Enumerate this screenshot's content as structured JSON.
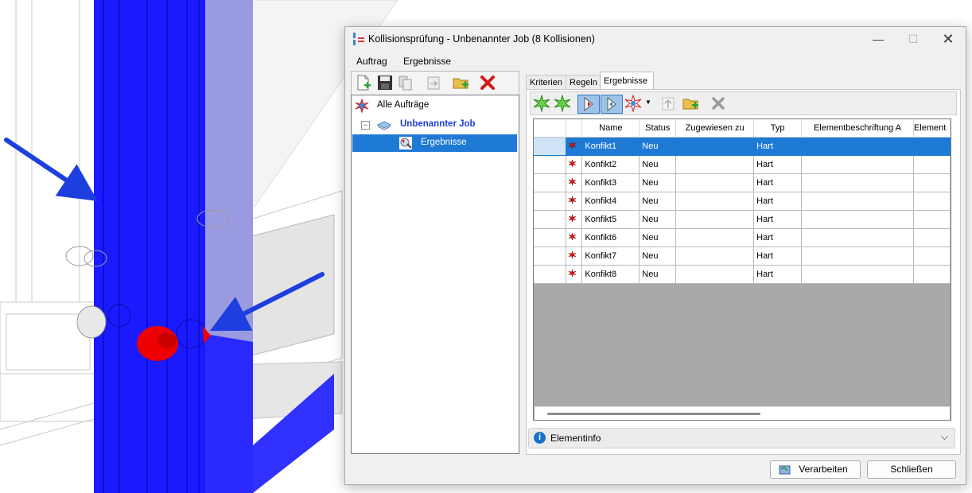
{
  "window": {
    "title": "Kollisionsprüfung - Unbenannter Job (8 Kollisionen)",
    "minimize_icon": "minimize-icon",
    "maximize_icon": "maximize-icon",
    "close_icon": "close-icon"
  },
  "menu": [
    "Auftrag",
    "Ergebnisse"
  ],
  "tree": {
    "root_label": "Alle Aufträge",
    "job_label": "Unbenannter Job",
    "results_label": "Ergebnisse",
    "expander": "−"
  },
  "tabs": [
    {
      "label": "Kriterien",
      "active": false
    },
    {
      "label": "Regeln",
      "active": false
    },
    {
      "label": "Ergebnisse",
      "active": true
    }
  ],
  "grid": {
    "columns": [
      "",
      "",
      "Name",
      "Status",
      "Zugewiesen zu",
      "Typ",
      "Elementbeschriftung A",
      "Element"
    ],
    "rows": [
      {
        "name": "Konfikt1",
        "status": "Neu",
        "assigned": "",
        "type": "Hart",
        "label_a": "",
        "selected": true
      },
      {
        "name": "Konfikt2",
        "status": "Neu",
        "assigned": "",
        "type": "Hart",
        "label_a": ""
      },
      {
        "name": "Konfikt3",
        "status": "Neu",
        "assigned": "",
        "type": "Hart",
        "label_a": ""
      },
      {
        "name": "Konfikt4",
        "status": "Neu",
        "assigned": "",
        "type": "Hart",
        "label_a": ""
      },
      {
        "name": "Konfikt5",
        "status": "Neu",
        "assigned": "",
        "type": "Hart",
        "label_a": ""
      },
      {
        "name": "Konfikt6",
        "status": "Neu",
        "assigned": "",
        "type": "Hart",
        "label_a": ""
      },
      {
        "name": "Konfikt7",
        "status": "Neu",
        "assigned": "",
        "type": "Hart",
        "label_a": ""
      },
      {
        "name": "Konfikt8",
        "status": "Neu",
        "assigned": "",
        "type": "Hart",
        "label_a": ""
      }
    ]
  },
  "infobar": {
    "label": "Elementinfo",
    "chevron": "⌄"
  },
  "buttons": {
    "process": "Verarbeiten",
    "close": "Schließen"
  },
  "colors": {
    "selection": "#1e7ad4",
    "steel_blue": "#1a1aff",
    "clash_red": "#ee0000",
    "arrow_blue": "#1d3fe0"
  }
}
